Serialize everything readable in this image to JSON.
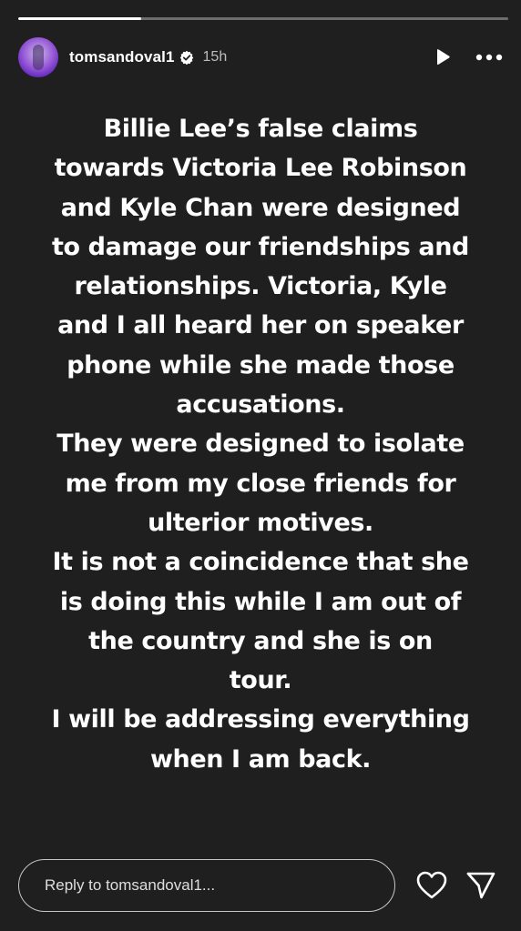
{
  "story": {
    "progress_fraction": 0.25,
    "text": "Billie Lee’s false claims\ntowards Victoria Lee Robinson\nand Kyle Chan were designed\nto damage our friendships and\nrelationships. Victoria, Kyle\nand I all heard her on speaker\nphone while she made those\naccusations.\nThey were designed to isolate\nme from my close friends for\nulterior motives.\nIt is not a coincidence that she\nis doing this while I am out of\nthe country and she is on\ntour.\nI will be addressing everything\nwhen I am back."
  },
  "header": {
    "username": "tomsandoval1",
    "verified": true,
    "time": "15h",
    "play_icon": "play-icon",
    "more_icon": "more-icon"
  },
  "footer": {
    "reply_placeholder": "Reply to tomsandoval1...",
    "reply_value": "",
    "heart_icon": "heart-icon",
    "send_icon": "send-icon"
  },
  "colors": {
    "background": "#1f1f1f",
    "text": "#ffffff",
    "avatar_accent": "#9b5fd9"
  }
}
